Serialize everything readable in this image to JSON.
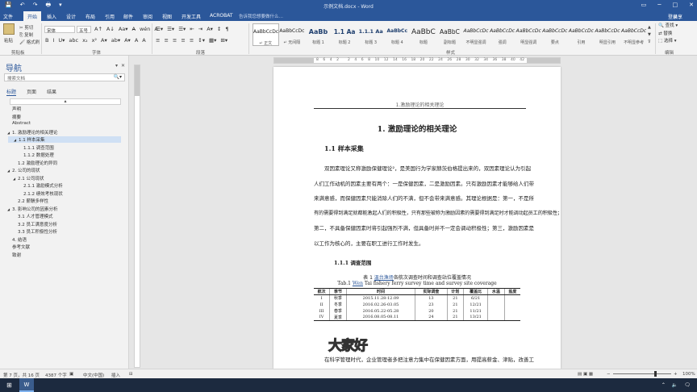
{
  "titlebar": {
    "title": "示例文档.docx - Word",
    "quick_access": [
      "💾",
      "↶",
      "↷",
      "🖶",
      "▾"
    ],
    "window_controls": [
      "▭",
      "─",
      "□",
      "✕"
    ]
  },
  "tabs": [
    "文件",
    "开始",
    "插入",
    "设计",
    "布局",
    "引用",
    "邮件",
    "审阅",
    "视图",
    "开发工具",
    "ACROBAT"
  ],
  "active_tab": "开始",
  "tell_me": "告诉我您想要做什么…",
  "user": "登录",
  "share": "共享",
  "ribbon": {
    "clipboard": {
      "paste": "粘贴",
      "cut": "剪切",
      "copy": "复制",
      "format_painter": "格式刷",
      "label": "剪贴板"
    },
    "font": {
      "name": "宋体",
      "size": "五号",
      "label": "字体",
      "row1": [
        "A↑",
        "A↓",
        "Aa▾",
        "A̶",
        "wén",
        "A"
      ],
      "row2": [
        "B",
        "I",
        "U▾",
        "abc",
        "x₂",
        "x²",
        "A▾",
        "ab▾",
        "A▾",
        "A",
        "A"
      ]
    },
    "paragraph": {
      "label": "段落",
      "row1": [
        "☰▾",
        "☰▾",
        "☰▾",
        "⇤",
        "⇥",
        "A▾",
        "↕",
        "¶"
      ],
      "row2": [
        "≡",
        "≡",
        "≡",
        "≡",
        "≡",
        "↕▾",
        "▦▾",
        "⊞▾"
      ]
    },
    "styles": {
      "label": "样式",
      "items": [
        {
          "preview": "AaBbCcDc",
          "name": "↵ 正文"
        },
        {
          "preview": "AaBbCcDc",
          "name": "↵ 无间隔"
        },
        {
          "preview": "AaBb",
          "name": "标题 1"
        },
        {
          "preview": "1.1 Aa",
          "name": "标题 2"
        },
        {
          "preview": "1.1.1 Aa",
          "name": "标题 3"
        },
        {
          "preview": "AaBbCc",
          "name": "标题 4"
        },
        {
          "preview": "AaBbC",
          "name": "标题"
        },
        {
          "preview": "AaBbC",
          "name": "副标题"
        },
        {
          "preview": "AaBbCcDc",
          "name": "不明显强调"
        },
        {
          "preview": "AaBbCcDc",
          "name": "强调"
        },
        {
          "preview": "AaBbCcDc",
          "name": "明显强调"
        },
        {
          "preview": "AaBbCcDc",
          "name": "要点"
        },
        {
          "preview": "AaBbCcDc",
          "name": "引用"
        },
        {
          "preview": "AaBbCcDc",
          "name": "明显引用"
        },
        {
          "preview": "AaBbCcDc",
          "name": "不明显参考"
        }
      ]
    },
    "editing": {
      "find": "查找 ▾",
      "replace": "替换",
      "select": "选择 ▾",
      "label": "编辑"
    }
  },
  "nav": {
    "title": "导航",
    "search_placeholder": "搜索文档",
    "tabs": [
      "标题",
      "页面",
      "结果"
    ],
    "active_tab": "标题",
    "items": [
      {
        "text": "声明",
        "level": 0,
        "arrow": ""
      },
      {
        "text": "摘要",
        "level": 0,
        "arrow": ""
      },
      {
        "text": "Abstract",
        "level": 0,
        "arrow": ""
      },
      {
        "text": "1. 激励理论的相关理论",
        "level": 0,
        "arrow": "◢"
      },
      {
        "text": "1.1 样本采集",
        "level": 1,
        "arrow": "◢",
        "selected": true
      },
      {
        "text": "1.1.1 调查范围",
        "level": 2,
        "arrow": ""
      },
      {
        "text": "1.1.2 数据处理",
        "level": 2,
        "arrow": ""
      },
      {
        "text": "1.2 激励理论的异同",
        "level": 1,
        "arrow": ""
      },
      {
        "text": "2. 公司的现状",
        "level": 0,
        "arrow": "◢"
      },
      {
        "text": "2.1 公司现状",
        "level": 1,
        "arrow": "◢"
      },
      {
        "text": "2.1.1 激励模式分析",
        "level": 2,
        "arrow": ""
      },
      {
        "text": "2.1.2 绩效考核现状",
        "level": 2,
        "arrow": ""
      },
      {
        "text": "2.2 薪酬多样性",
        "level": 1,
        "arrow": ""
      },
      {
        "text": "3. 影响公司的因素分析",
        "level": 0,
        "arrow": "◢"
      },
      {
        "text": "3.1 人才管理模式",
        "level": 1,
        "arrow": ""
      },
      {
        "text": "3.2 员工满意度分析",
        "level": 1,
        "arrow": ""
      },
      {
        "text": "3.3 员工积极性分析",
        "level": 1,
        "arrow": ""
      },
      {
        "text": "4. 结语",
        "level": 0,
        "arrow": ""
      },
      {
        "text": "参考文献",
        "level": 0,
        "arrow": ""
      },
      {
        "text": "致谢",
        "level": 0,
        "arrow": ""
      }
    ]
  },
  "ruler_marks": [
    "8",
    "6",
    "4",
    "2",
    "",
    "2",
    "4",
    "6",
    "8",
    "10",
    "12",
    "14",
    "16",
    "18",
    "20",
    "22",
    "24",
    "26",
    "28",
    "30",
    "32",
    "34",
    "36",
    "38",
    "40",
    "42"
  ],
  "doc": {
    "header": "1.激励理论的相关理论",
    "h1": "1. 激励理论的相关理论",
    "h2": "1.1 样本采集",
    "para": [
      "双因素理论又称激励保健理论²，是美国行为学家赫茨伯格提出来的，双因素理论认为引起",
      "人们工作动机的因素主要有两个：一是保健因素，二是激励因素。只有激励因素才能够给人们带",
      "来满意感，而保健因素只能消除人们的不满，但不会带来满意感。其理论根据是：第一，不是所",
      "有的需要得到满足就都能激起人们的积极性，只有那些被称为激励因素的需要得到满足时才能调动起员工的积极性；",
      "第二，不具备保健因素时将引起强烈不满，但具备时并不一定会调动积极性；第三，激励因素是",
      "以工作为核心的，主要在职工进行工作时发生。"
    ],
    "h3": "1.1.1 调查范围",
    "caption_cn_pre": "表 1 ",
    "caption_cn_link": "温台渔场",
    "caption_cn_post": "各航次调查时间和调查站位覆盖情况",
    "caption_en_pre": "Tab.1 ",
    "caption_en_link": "Wen",
    "caption_en_post": " Tai fishery ferry survey time and survey site coverage",
    "table": {
      "headers": [
        "航次",
        "季节",
        "时间",
        "实际调查",
        "计划",
        "覆盖比",
        "水温",
        "盐度"
      ],
      "rows": [
        [
          "I",
          "秋季",
          "2015.11.28-12.09",
          "13",
          "21",
          "6/21",
          "",
          ""
        ],
        [
          "II",
          "冬季",
          "2016.02.26-03.05",
          "23",
          "21",
          "12/21",
          "",
          ""
        ],
        [
          "III",
          "春季",
          "2016.05.22-05.28",
          "20",
          "21",
          "11/21",
          "",
          ""
        ],
        [
          "IV",
          "夏季",
          "2016.08.05-08.11",
          "24",
          "21",
          "13/21",
          "",
          ""
        ]
      ]
    },
    "watermark": "大家好",
    "last_para": "在科学管理时代，企业管理者多把注意力集中在保健因素方面，用提高薪金、津贴，改善工"
  },
  "status": {
    "page": "第 7 页，共 16 页",
    "words": "4387 个字",
    "lang": "中文(中国)",
    "insert": "插入",
    "zoom": "100%"
  },
  "taskbar": {
    "start": "⊞",
    "app": "W",
    "tray": [
      "⌃",
      "🔈",
      "🗨"
    ]
  }
}
